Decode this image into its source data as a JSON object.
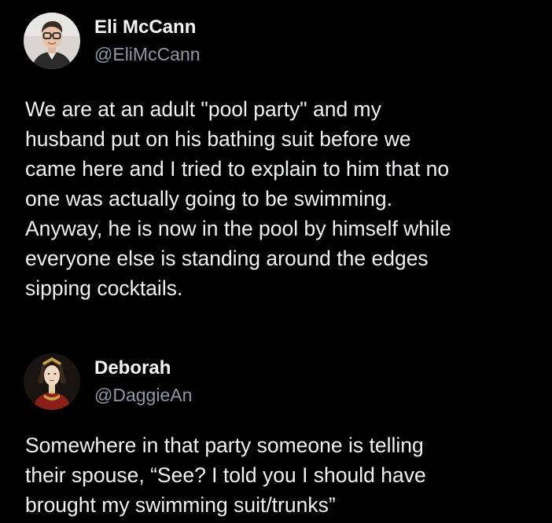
{
  "posts": [
    {
      "author": {
        "display_name": "Eli McCann",
        "handle": "@EliMcCann",
        "avatar_icon": "profile-photo-man-glasses"
      },
      "text_lines": [
        "We are at an adult \"pool party\" and my",
        "husband put on his bathing suit before we",
        "came here and I tried to explain to him that no",
        "one was actually going to be swimming.",
        "Anyway, he is now in the pool by himself while",
        "everyone else is standing around the edges",
        "sipping cocktails."
      ]
    },
    {
      "author": {
        "display_name": "Deborah",
        "handle": "@DaggieAn",
        "avatar_icon": "profile-photo-tudor-portrait"
      },
      "text_lines": [
        "Somewhere in that party someone is telling",
        "their spouse, “See?  I told you I should have",
        "brought my swimming suit/trunks”"
      ]
    }
  ],
  "colors": {
    "background": "#000000",
    "text": "#e7e9ea",
    "secondary": "#8b98a5"
  }
}
